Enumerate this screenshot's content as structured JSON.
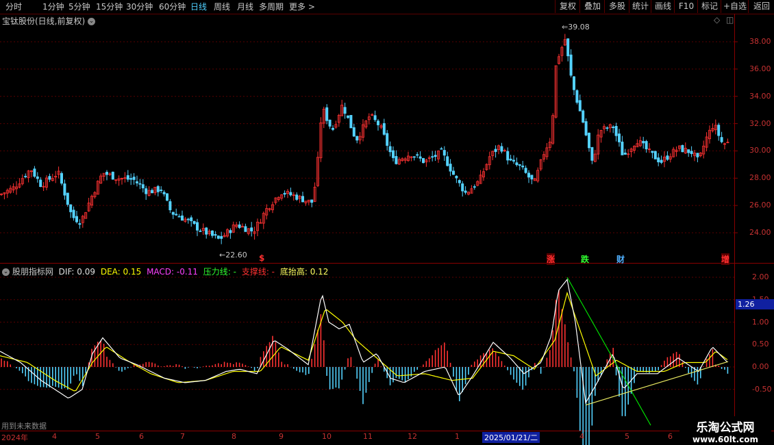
{
  "toolbar": {
    "timeframes": [
      "分时",
      "1分钟",
      "5分钟",
      "15分钟",
      "30分钟",
      "60分钟",
      "日线",
      "周线",
      "月线",
      "多周期",
      "更多 >"
    ],
    "active_timeframe": "日线",
    "right_buttons": [
      "复权",
      "叠加",
      "多股",
      "统计",
      "画线",
      "F10",
      "标记",
      "+自选",
      "返回"
    ]
  },
  "price_pane": {
    "title": "宝钛股份(日线,前复权)",
    "y_ticks": [
      "38.00",
      "36.00",
      "34.00",
      "32.00",
      "30.00",
      "28.00",
      "26.00",
      "24.00"
    ],
    "y_values": [
      38,
      36,
      34,
      32,
      30,
      28,
      26,
      24
    ],
    "high_label": "39.08",
    "low_label": "22.60",
    "event_tags": [
      {
        "text": "$",
        "color": "#ff3030"
      },
      {
        "text": "涨",
        "color": "#ff3030"
      },
      {
        "text": "跌",
        "color": "#30ff30"
      },
      {
        "text": "财",
        "color": "#4fb0ff"
      },
      {
        "text": "增",
        "color": "#ff3030"
      }
    ]
  },
  "indicator_pane": {
    "name": "股朋指标网",
    "dif_label": "DIF: 0.09",
    "dea_label": "DEA: 0.15",
    "macd_label": "MACD: -0.11",
    "pressure_label": "压力线: -",
    "support_label": "支撑线: -",
    "bottom_label": "底抬高: 0.12",
    "y_ticks": [
      "2.00",
      "1.50",
      "1.00",
      "0.50",
      "0.00",
      "-0.50"
    ],
    "current_value": "1.26",
    "footnote": "用到未来数据",
    "colors": {
      "dif": "#ffffff",
      "dea": "#ffff00",
      "pressure": "#00ff00",
      "support": "#ff3030",
      "bottom": "#ffff60",
      "macd": "#ff40ff",
      "up": "#ff3232",
      "down": "#54d2ff"
    }
  },
  "x_axis": {
    "labels": [
      "2024年",
      "4",
      "5",
      "6",
      "7",
      "8",
      "9",
      "10",
      "11",
      "12",
      "1",
      "2025/01/21/二",
      "4",
      "5",
      "6"
    ]
  },
  "watermark": {
    "title": "乐淘公式网",
    "url": "www.60lt.com"
  },
  "chart_data": {
    "type": "candlestick",
    "title": "宝钛股份(日线,前复权)",
    "ylim": [
      23,
      39.5
    ],
    "price_high": 39.08,
    "price_low": 22.6,
    "price_path": [
      [
        0,
        26.8
      ],
      [
        20,
        27.3
      ],
      [
        45,
        28.7
      ],
      [
        60,
        27.5
      ],
      [
        85,
        28.4
      ],
      [
        105,
        25.2
      ],
      [
        118,
        24.8
      ],
      [
        135,
        26.8
      ],
      [
        150,
        28.4
      ],
      [
        172,
        28.0
      ],
      [
        195,
        27.9
      ],
      [
        215,
        27.0
      ],
      [
        235,
        27.2
      ],
      [
        250,
        25.5
      ],
      [
        270,
        25.0
      ],
      [
        290,
        24.3
      ],
      [
        320,
        23.5
      ],
      [
        345,
        24.6
      ],
      [
        370,
        24.1
      ],
      [
        390,
        25.8
      ],
      [
        410,
        27.0
      ],
      [
        430,
        26.7
      ],
      [
        455,
        26.2
      ],
      [
        462,
        28.0
      ],
      [
        470,
        33.2
      ],
      [
        485,
        31.5
      ],
      [
        500,
        33.4
      ],
      [
        520,
        30.8
      ],
      [
        540,
        32.6
      ],
      [
        555,
        31.8
      ],
      [
        575,
        29.2
      ],
      [
        600,
        29.8
      ],
      [
        620,
        29.2
      ],
      [
        645,
        29.9
      ],
      [
        665,
        28.0
      ],
      [
        680,
        26.9
      ],
      [
        700,
        27.8
      ],
      [
        715,
        29.6
      ],
      [
        730,
        30.4
      ],
      [
        745,
        29.2
      ],
      [
        760,
        28.8
      ],
      [
        780,
        27.6
      ],
      [
        795,
        30.0
      ],
      [
        805,
        31.0
      ],
      [
        812,
        36.5
      ],
      [
        825,
        38.2
      ],
      [
        835,
        35.0
      ],
      [
        852,
        32.0
      ],
      [
        865,
        29.0
      ],
      [
        875,
        31.5
      ],
      [
        895,
        31.8
      ],
      [
        910,
        29.6
      ],
      [
        930,
        30.8
      ],
      [
        950,
        29.8
      ],
      [
        965,
        29.2
      ],
      [
        990,
        30.2
      ],
      [
        1010,
        29.9
      ],
      [
        1020,
        29.2
      ],
      [
        1030,
        30.8
      ],
      [
        1042,
        32.0
      ],
      [
        1055,
        30.5
      ],
      [
        1063,
        30.6
      ]
    ],
    "indicator": {
      "ylim": [
        -0.9,
        2.2
      ],
      "dif_path": [
        [
          0,
          0.35
        ],
        [
          30,
          0.1
        ],
        [
          60,
          -0.3
        ],
        [
          100,
          -0.7
        ],
        [
          120,
          -0.5
        ],
        [
          135,
          0.3
        ],
        [
          150,
          0.65
        ],
        [
          175,
          0.2
        ],
        [
          200,
          0.05
        ],
        [
          240,
          -0.25
        ],
        [
          270,
          -0.35
        ],
        [
          300,
          -0.3
        ],
        [
          330,
          -0.1
        ],
        [
          350,
          -0.05
        ],
        [
          375,
          -0.15
        ],
        [
          400,
          0.6
        ],
        [
          420,
          0.4
        ],
        [
          450,
          0.05
        ],
        [
          470,
          1.65
        ],
        [
          480,
          1.0
        ],
        [
          495,
          0.85
        ],
        [
          510,
          0.95
        ],
        [
          530,
          0.1
        ],
        [
          550,
          0.3
        ],
        [
          570,
          -0.25
        ],
        [
          590,
          -0.35
        ],
        [
          620,
          -0.1
        ],
        [
          650,
          0.0
        ],
        [
          670,
          -0.65
        ],
        [
          690,
          -0.2
        ],
        [
          720,
          0.55
        ],
        [
          745,
          0.2
        ],
        [
          765,
          -0.15
        ],
        [
          790,
          0.1
        ],
        [
          805,
          0.7
        ],
        [
          815,
          1.7
        ],
        [
          828,
          1.95
        ],
        [
          840,
          1.0
        ],
        [
          855,
          -0.8
        ],
        [
          870,
          -0.4
        ],
        [
          895,
          0.3
        ],
        [
          910,
          -0.5
        ],
        [
          930,
          -0.15
        ],
        [
          960,
          -0.15
        ],
        [
          990,
          0.2
        ],
        [
          1020,
          -0.1
        ],
        [
          1040,
          0.45
        ],
        [
          1063,
          0.09
        ]
      ],
      "dea_path": [
        [
          0,
          0.25
        ],
        [
          40,
          0.1
        ],
        [
          80,
          -0.3
        ],
        [
          110,
          -0.55
        ],
        [
          135,
          0.1
        ],
        [
          155,
          0.45
        ],
        [
          185,
          0.15
        ],
        [
          220,
          -0.15
        ],
        [
          260,
          -0.35
        ],
        [
          300,
          -0.3
        ],
        [
          340,
          -0.1
        ],
        [
          380,
          -0.1
        ],
        [
          410,
          0.45
        ],
        [
          450,
          0.15
        ],
        [
          475,
          1.3
        ],
        [
          500,
          1.0
        ],
        [
          520,
          0.6
        ],
        [
          550,
          0.2
        ],
        [
          580,
          -0.2
        ],
        [
          620,
          -0.15
        ],
        [
          660,
          -0.3
        ],
        [
          690,
          -0.25
        ],
        [
          720,
          0.35
        ],
        [
          750,
          0.25
        ],
        [
          780,
          -0.05
        ],
        [
          810,
          0.6
        ],
        [
          828,
          1.65
        ],
        [
          845,
          0.9
        ],
        [
          870,
          -0.2
        ],
        [
          900,
          0.15
        ],
        [
          930,
          -0.1
        ],
        [
          970,
          -0.1
        ],
        [
          1000,
          0.1
        ],
        [
          1030,
          0.1
        ],
        [
          1045,
          0.35
        ],
        [
          1063,
          0.15
        ]
      ],
      "pressure_line": [
        [
          828,
          2.0
        ],
        [
          950,
          -1.3
        ]
      ],
      "bottom_line": [
        [
          855,
          -0.85
        ],
        [
          1063,
          0.12
        ]
      ]
    }
  }
}
